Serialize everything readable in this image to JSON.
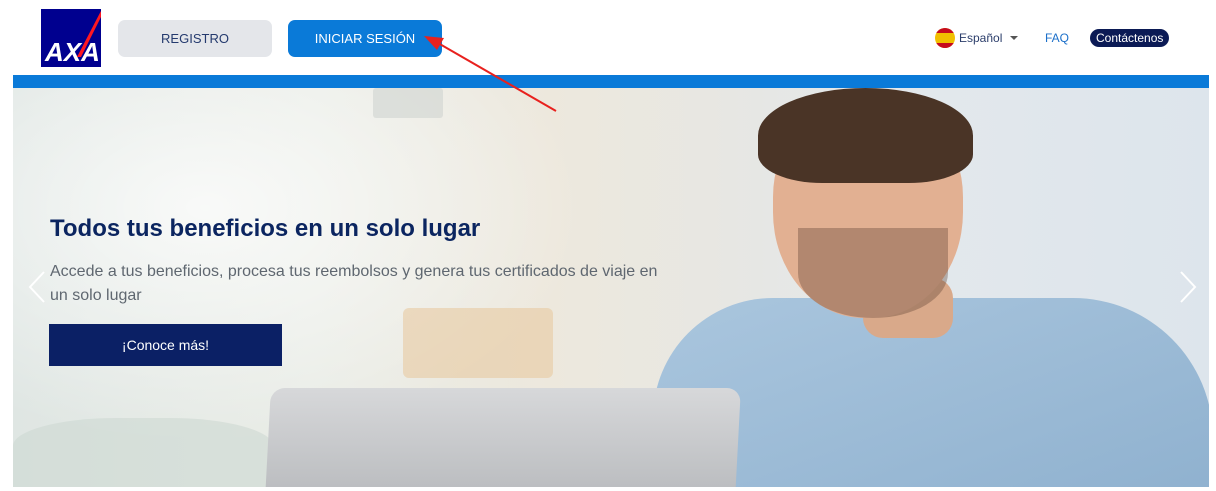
{
  "header": {
    "logo_text": "AXA",
    "register_label": "REGISTRO",
    "login_label": "INICIAR SESIÓN",
    "language_label": "Español",
    "faq_label": "FAQ",
    "contact_label": "Contáctenos"
  },
  "hero": {
    "title": "Todos tus beneficios en un solo lugar",
    "subtitle": "Accede a tus beneficios, procesa tus reembolsos y genera tus certificados de viaje en un solo lugar",
    "cta_label": "¡Conoce más!"
  },
  "icons": {
    "flag": "spain-flag-icon",
    "language_caret": "caret-down-icon",
    "prev": "chevron-left-icon",
    "next": "chevron-right-icon"
  },
  "colors": {
    "brand_blue": "#00008f",
    "accent_blue": "#0a7ad8",
    "navy": "#0b2065",
    "annotation_red": "#e8211e"
  }
}
